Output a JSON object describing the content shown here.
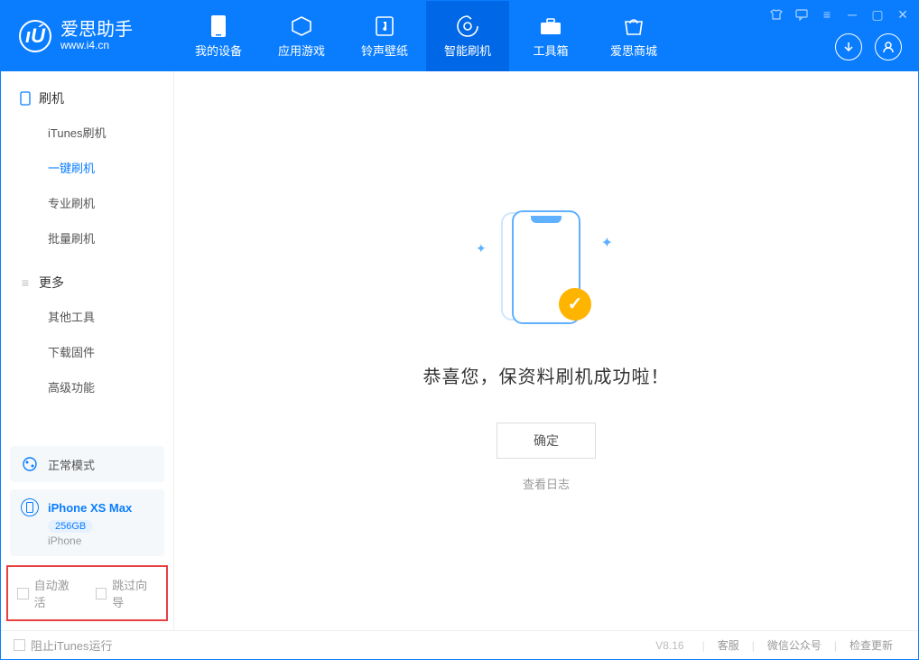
{
  "header": {
    "app_title": "爱思助手",
    "app_url": "www.i4.cn",
    "tabs": [
      {
        "label": "我的设备"
      },
      {
        "label": "应用游戏"
      },
      {
        "label": "铃声壁纸"
      },
      {
        "label": "智能刷机"
      },
      {
        "label": "工具箱"
      },
      {
        "label": "爱思商城"
      }
    ]
  },
  "sidebar": {
    "sec1_title": "刷机",
    "items1": [
      {
        "label": "iTunes刷机"
      },
      {
        "label": "一键刷机"
      },
      {
        "label": "专业刷机"
      },
      {
        "label": "批量刷机"
      }
    ],
    "sec2_title": "更多",
    "items2": [
      {
        "label": "其他工具"
      },
      {
        "label": "下载固件"
      },
      {
        "label": "高级功能"
      }
    ],
    "mode_label": "正常模式",
    "device_name": "iPhone XS Max",
    "device_storage": "256GB",
    "device_type": "iPhone",
    "chk_auto_activate": "自动激活",
    "chk_skip_guide": "跳过向导"
  },
  "main": {
    "success_text": "恭喜您，保资料刷机成功啦！",
    "ok_button": "确定",
    "view_log": "查看日志"
  },
  "footer": {
    "block_itunes": "阻止iTunes运行",
    "version": "V8.16",
    "link_service": "客服",
    "link_wechat": "微信公众号",
    "link_update": "检查更新"
  }
}
